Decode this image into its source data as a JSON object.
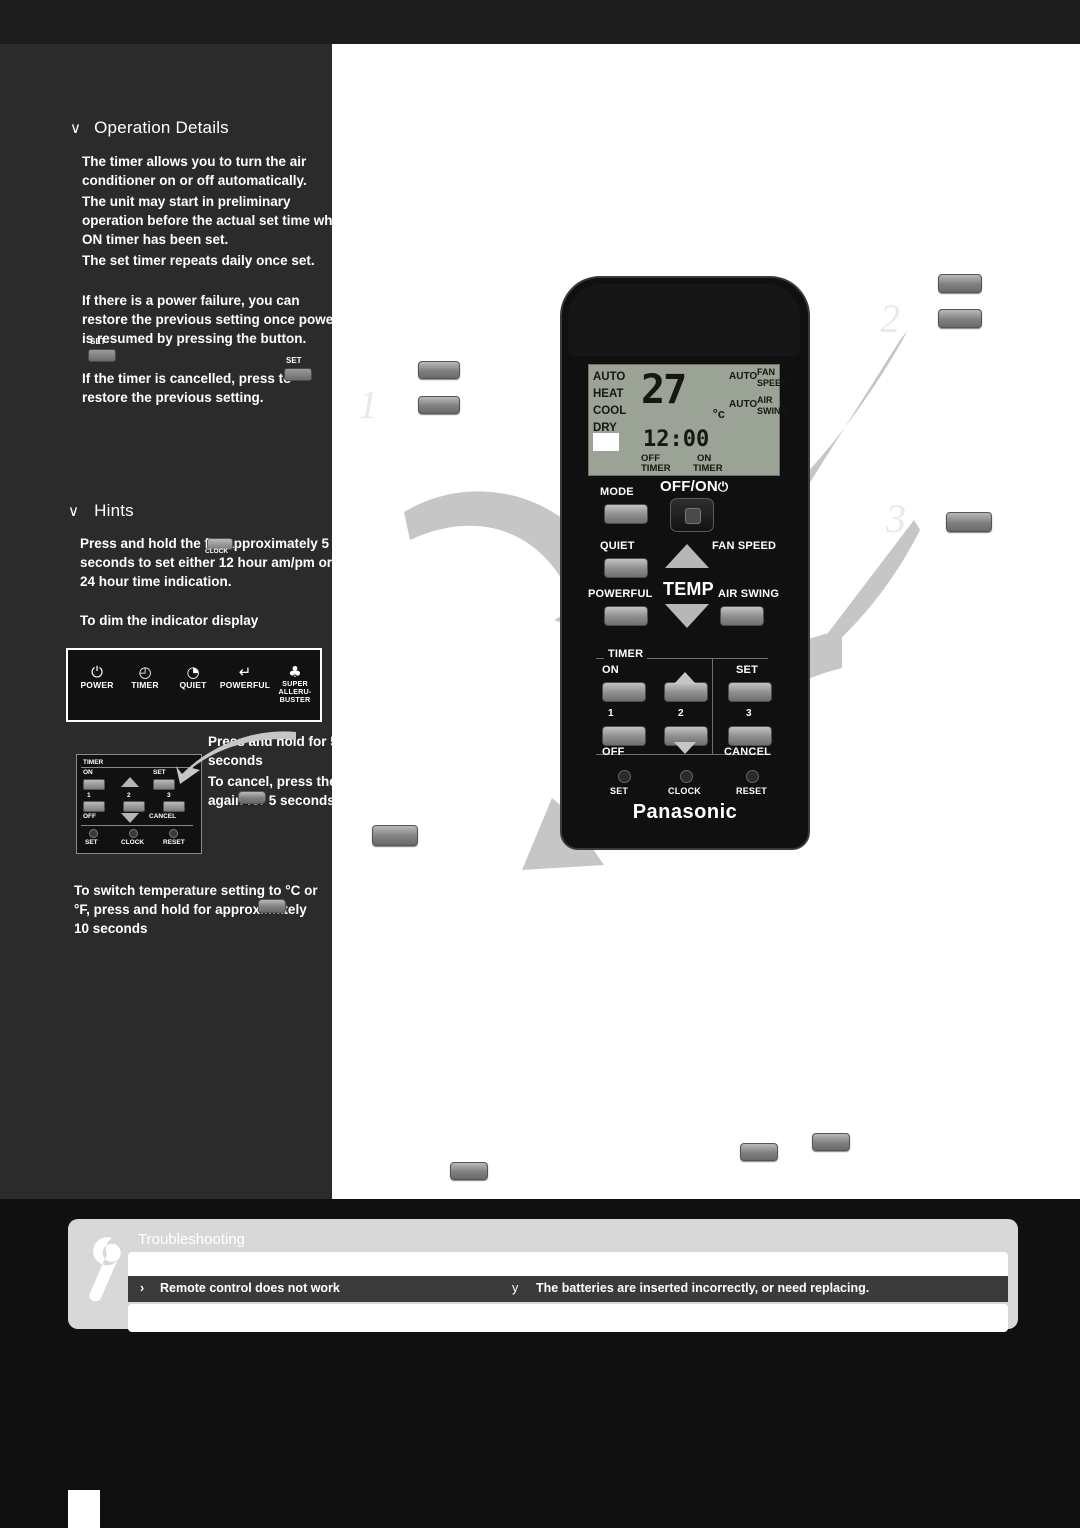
{
  "left": {
    "operation_details": {
      "bullet": "∨",
      "title": "Operation Details",
      "paragraphs": [
        "The timer allows you to turn the air conditioner on or off automatically.",
        "The unit may start in preliminary operation before the actual set time when ON timer has been set.",
        "The set timer repeats daily once set.",
        "If there is a power failure, you can restore the previous setting once power is resumed by pressing the        button.",
        "If the timer is cancelled, press        to restore the previous setting."
      ],
      "set_label": "SET"
    },
    "hints": {
      "bullet": "∨",
      "title": "Hints",
      "paragraphs": [
        "Press and hold the        for approximately 5 seconds to set either 12 hour am/pm or 24 hour time indication.",
        "To dim the indicator display"
      ],
      "clock_label": "CLOCK"
    },
    "indicator_panel": {
      "items": [
        {
          "icon": "⏻",
          "label": "POWER",
          "icon_name": "power-icon"
        },
        {
          "icon": "◴",
          "label": "TIMER",
          "icon_name": "timer-clock-icon"
        },
        {
          "icon": "◔",
          "label": "QUIET",
          "icon_name": "quiet-icon"
        },
        {
          "icon": "↵",
          "label": "POWERFUL",
          "icon_name": "powerful-icon"
        },
        {
          "icon": "♣",
          "label": "SUPER ALLERU-BUSTER",
          "icon_name": "alleru-buster-icon"
        }
      ]
    },
    "mini_remote": {
      "timer": "TIMER",
      "on": "ON",
      "off": "OFF",
      "set": "SET",
      "cancel": "CANCEL",
      "nums": [
        "1",
        "2",
        "3"
      ],
      "set_small": "SET",
      "clock": "CLOCK",
      "reset": "RESET"
    },
    "dim_instructions": [
      "Press and hold for 5 seconds",
      "To cancel, press the        again for 5 seconds"
    ],
    "switch_instruction": "To switch temperature setting to °C or °F, press and hold        for approximately 10 seconds",
    "steps": [
      "1",
      "2",
      "3"
    ]
  },
  "remote": {
    "brand": "Panasonic",
    "lcd": {
      "modes": [
        "AUTO",
        "HEAT",
        "COOL",
        "DRY"
      ],
      "temperature": "27",
      "temp_unit": "°c",
      "clock": "12:00",
      "right_labels": [
        "AUTO",
        "AUTO"
      ],
      "fan_speed": "FAN SPEED",
      "air_swing": "AIR SWING",
      "off_timer_top": "OFF",
      "off_timer_bottom": "TIMER",
      "on_timer_top": "ON",
      "on_timer_bottom": "TIMER"
    },
    "buttons": {
      "mode": "MODE",
      "off_on": "OFF/ON",
      "off_on_symbol": "⏻",
      "quiet": "QUIET",
      "fan_speed": "FAN SPEED",
      "powerful": "POWERFUL",
      "air_swing": "AIR SWING",
      "temp": "TEMP",
      "timer": "TIMER",
      "on": "ON",
      "off": "OFF",
      "set": "SET",
      "cancel": "CANCEL",
      "nums": [
        "1",
        "2",
        "3"
      ],
      "set_small": "SET",
      "clock": "CLOCK",
      "reset": "RESET"
    }
  },
  "troubleshooting": {
    "title": "Troubleshooting",
    "symbol_left": "›",
    "problem": "Remote control does not work",
    "symbol_right": "y",
    "solution": "The batteries are inserted incorrectly, or need replacing."
  },
  "colors": {
    "page_bg": "#0c0c0c",
    "panel_bg": "#2b2b2b",
    "content_bg": "#ffffff",
    "lcd": "#9ba296",
    "accent_band": "#3b3b3b"
  }
}
